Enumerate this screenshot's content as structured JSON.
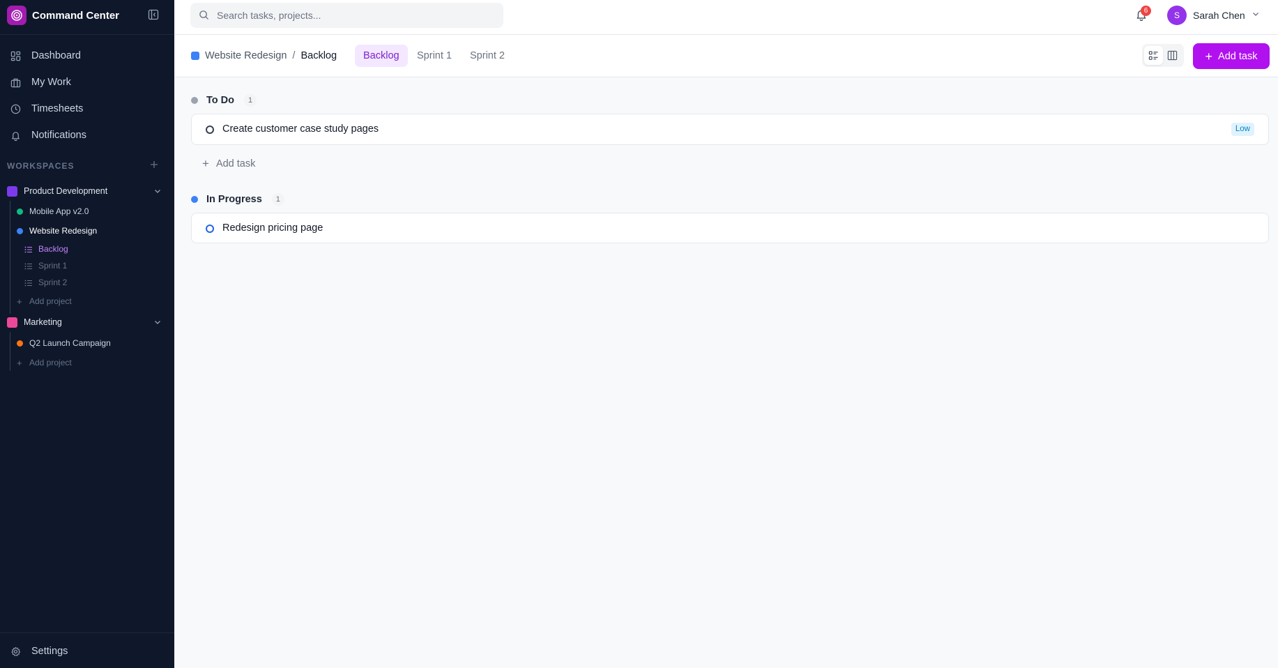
{
  "app": {
    "title": "Command Center"
  },
  "nav": [
    {
      "label": "Dashboard",
      "icon": "dashboard-icon"
    },
    {
      "label": "My Work",
      "icon": "briefcase-icon"
    },
    {
      "label": "Timesheets",
      "icon": "clock-icon"
    },
    {
      "label": "Notifications",
      "icon": "bell-icon"
    }
  ],
  "workspaces": {
    "header": "WORKSPACES",
    "items": [
      {
        "name": "Product Development",
        "color": "#7c3aed",
        "projects": [
          {
            "name": "Mobile App v2.0",
            "color": "#10b981"
          },
          {
            "name": "Website Redesign",
            "color": "#3b82f6",
            "lists": [
              {
                "label": "Backlog"
              },
              {
                "label": "Sprint 1"
              },
              {
                "label": "Sprint 2"
              }
            ]
          }
        ],
        "add_project": "Add project"
      },
      {
        "name": "Marketing",
        "color": "#ec4899",
        "projects": [
          {
            "name": "Q2 Launch Campaign",
            "color": "#f97316"
          }
        ],
        "add_project": "Add project"
      }
    ]
  },
  "footer": {
    "settings": "Settings"
  },
  "topbar": {
    "search_placeholder": "Search tasks, projects...",
    "notification_count": "6",
    "user": {
      "initial": "S",
      "name": "Sarah Chen"
    }
  },
  "subheader": {
    "breadcrumb": {
      "project": "Website Redesign",
      "separator": "/",
      "current": "Backlog",
      "color": "#3b82f6"
    },
    "tabs": [
      {
        "label": "Backlog"
      },
      {
        "label": "Sprint 1"
      },
      {
        "label": "Sprint 2"
      }
    ],
    "add_task": "Add task"
  },
  "groups": [
    {
      "title": "To Do",
      "count": "1",
      "color": "#9ca3af",
      "tasks": [
        {
          "title": "Create customer case study pages",
          "priority": "Low"
        }
      ],
      "add_task": "Add task"
    },
    {
      "title": "In Progress",
      "count": "1",
      "color": "#3b82f6",
      "tasks": [
        {
          "title": "Redesign pricing page"
        }
      ]
    }
  ],
  "colors": {
    "accent": "#b011ee",
    "sidebar_bg": "#0f172a"
  }
}
